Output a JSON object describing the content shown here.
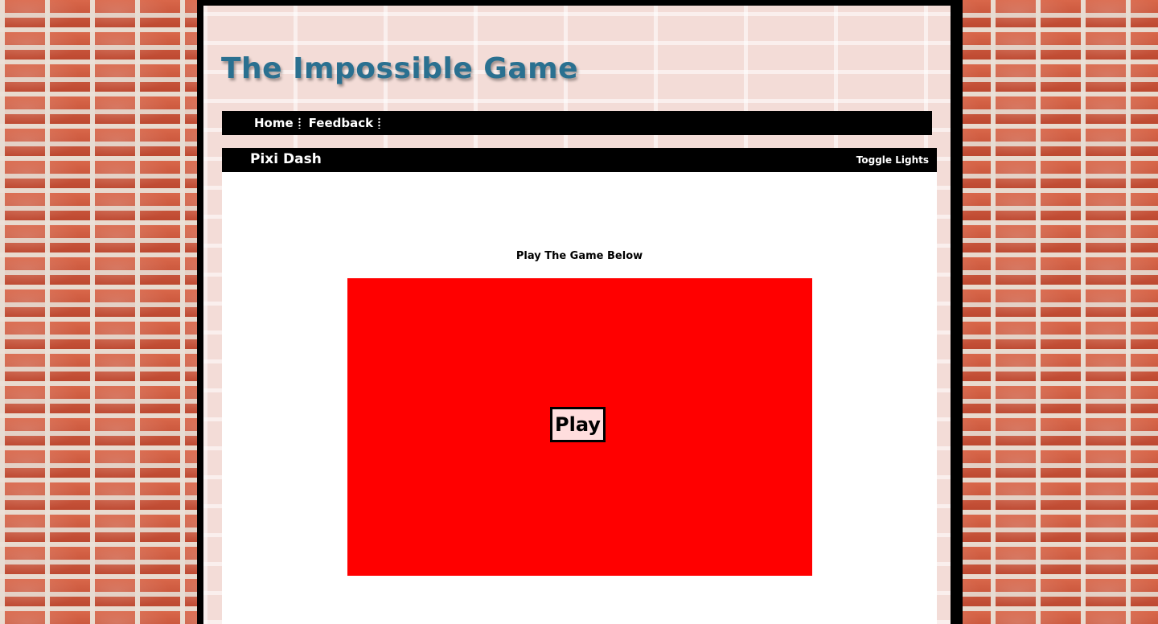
{
  "site": {
    "title": "The Impossible Game"
  },
  "nav": {
    "items": [
      {
        "label": "Home"
      },
      {
        "label": "Feedback"
      }
    ]
  },
  "game": {
    "name": "Pixi Dash",
    "toggle_label": "Toggle Lights",
    "instructions": "Play The Game Below",
    "play_label": "Play",
    "canvas_color": "#ff0000",
    "play_button_bg": "#ffdddd"
  },
  "colors": {
    "title": "#2a7090",
    "bars": "#000000",
    "brick": "#c9553a"
  }
}
